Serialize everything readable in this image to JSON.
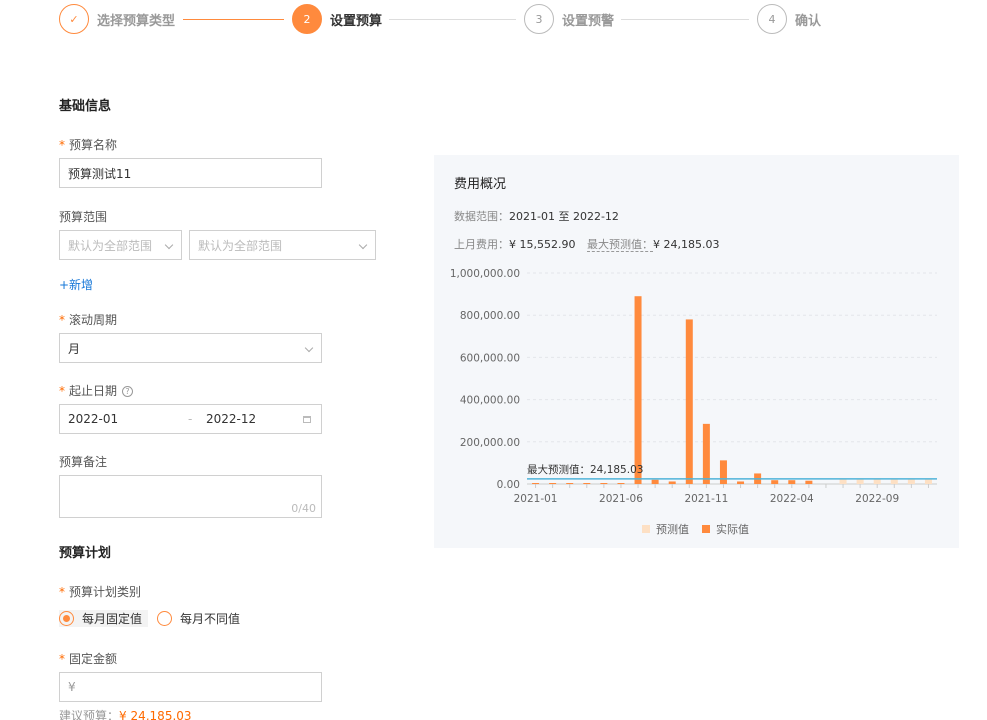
{
  "steps": [
    {
      "num": "✓",
      "label": "选择预算类型",
      "state": "done"
    },
    {
      "num": "2",
      "label": "设置预算",
      "state": "active"
    },
    {
      "num": "3",
      "label": "设置预警",
      "state": "pending"
    },
    {
      "num": "4",
      "label": "确认",
      "state": "pending"
    }
  ],
  "basic": {
    "title": "基础信息",
    "name_label": "预算名称",
    "name_value": "预算测试11",
    "scope_label": "预算范围",
    "scope_placeholder_1": "默认为全部范围",
    "scope_placeholder_2": "默认为全部范围",
    "add_link": "+新增",
    "period_label": "滚动周期",
    "period_value": "月",
    "date_label": "起止日期",
    "date_start": "2022-01",
    "date_sep": "-",
    "date_end": "2022-12",
    "help_glyph": "?",
    "remark_label": "预算备注",
    "remark_counter": "0/40"
  },
  "plan": {
    "title": "预算计划",
    "type_label": "预算计划类别",
    "option_fixed": "每月固定值",
    "option_varied": "每月不同值",
    "amount_label": "固定金额",
    "amount_placeholder": "¥",
    "suggest_label": "建议预算：",
    "suggest_value": "¥ 24,185.03"
  },
  "panel": {
    "title": "费用概况",
    "range_label": "数据范围：",
    "range_start": "2021-01",
    "range_sep": "至",
    "range_end": "2022-12",
    "last_month_label": "上月费用：",
    "last_month_value": "¥ 15,552.90",
    "max_label": "最大预测值：",
    "max_value": "¥ 24,185.03"
  },
  "colors": {
    "accent": "#ff8a3d",
    "actual": "#ff8a3d",
    "forecast": "#fde0c4",
    "refline": "#4fb3d9"
  },
  "chart_data": {
    "type": "bar",
    "categories": [
      "2021-01",
      "2021-02",
      "2021-03",
      "2021-04",
      "2021-05",
      "2021-06",
      "2021-07",
      "2021-08",
      "2021-09",
      "2021-10",
      "2021-11",
      "2021-12",
      "2022-01",
      "2022-02",
      "2022-03",
      "2022-04",
      "2022-05",
      "2022-06",
      "2022-07",
      "2022-08",
      "2022-09",
      "2022-10",
      "2022-11",
      "2022-12"
    ],
    "x_ticks": [
      "2021-01",
      "2021-06",
      "2021-11",
      "2022-04",
      "2022-09"
    ],
    "y_ticks": [
      "1,000,000.00",
      "800,000.00",
      "600,000.00",
      "400,000.00",
      "200,000.00",
      "0.00"
    ],
    "ylim": [
      0,
      1000000
    ],
    "series": [
      {
        "name": "预测值",
        "values": [
          null,
          null,
          null,
          null,
          null,
          null,
          null,
          null,
          null,
          null,
          null,
          null,
          null,
          null,
          null,
          null,
          null,
          null,
          24185.03,
          24185.03,
          24185.03,
          24185.03,
          24185.03,
          24185.03
        ]
      },
      {
        "name": "实际值",
        "values": [
          0,
          0,
          0,
          0,
          0,
          1500,
          890000,
          20000,
          12000,
          780000,
          285000,
          112000,
          12000,
          50000,
          18000,
          18000,
          15552.9,
          null,
          null,
          null,
          null,
          null,
          null,
          null
        ]
      }
    ],
    "reference_line": {
      "value": 24185.03,
      "label": "最大预测值：24,185.03"
    },
    "legend": [
      "预测值",
      "实际值"
    ],
    "legend_position": "bottom"
  }
}
